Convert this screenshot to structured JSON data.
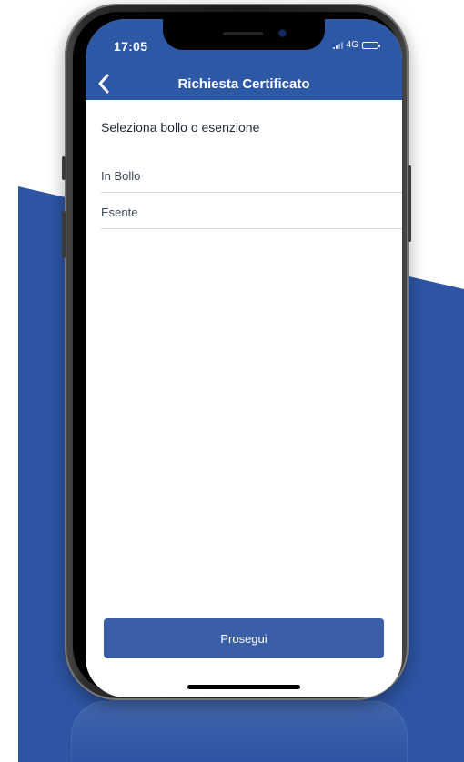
{
  "colors": {
    "brand": "#2d58a6",
    "button": "#3a5ea8",
    "backdrop": "#2d55a4"
  },
  "status_bar": {
    "time": "17:05",
    "network": "4G",
    "signal_icon": "cellular-signal-icon",
    "battery_icon": "battery-icon"
  },
  "header": {
    "back_icon": "chevron-left-icon",
    "title": "Richiesta Certificato"
  },
  "main": {
    "section_title": "Seleziona bollo o esenzione",
    "options": [
      {
        "label": "In Bollo"
      },
      {
        "label": "Esente"
      }
    ],
    "proceed_label": "Prosegui"
  }
}
